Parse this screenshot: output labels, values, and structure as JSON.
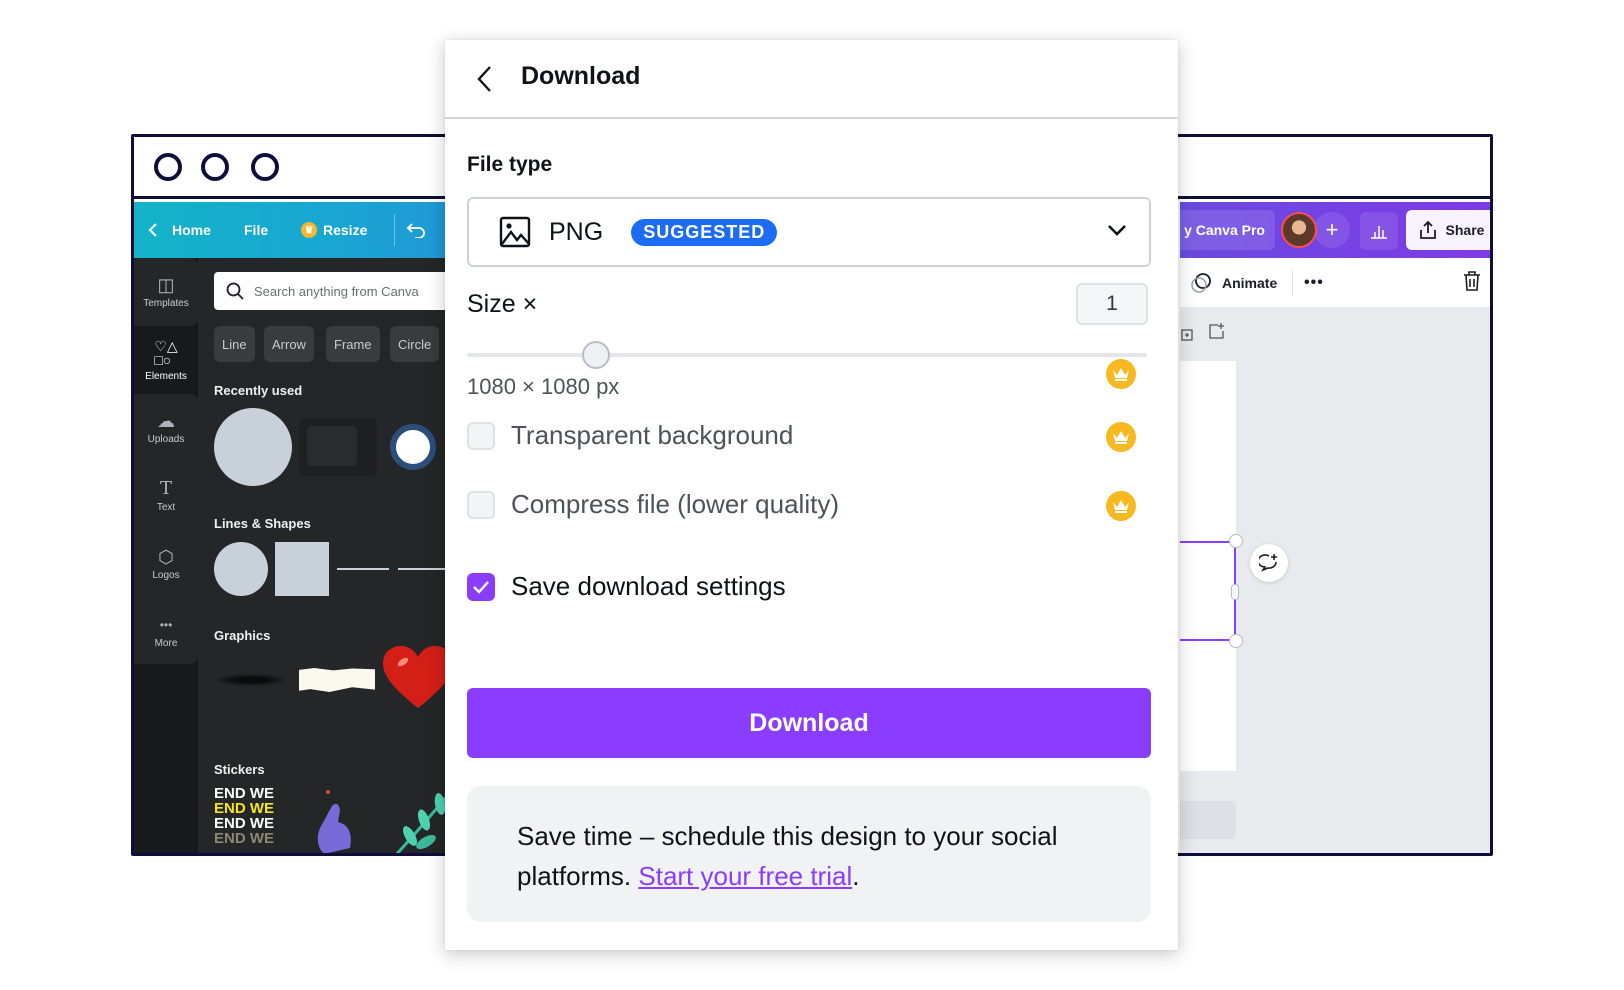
{
  "window": {
    "traffic_lights": [
      "circle",
      "circle",
      "circle"
    ]
  },
  "left_app": {
    "toolbar": {
      "back_icon": "chevron-left-icon",
      "home_label": "Home",
      "file_label": "File",
      "resize_label": "Resize",
      "resize_icon": "crown-icon",
      "undo_icon": "undo-icon"
    },
    "sidebar": {
      "items": [
        {
          "label": "Templates",
          "icon": "templates-icon",
          "glyph": "◫"
        },
        {
          "label": "Elements",
          "icon": "elements-icon",
          "glyph": "♡△"
        },
        {
          "label": "Uploads",
          "icon": "cloud-upload-icon",
          "glyph": "☁"
        },
        {
          "label": "Text",
          "icon": "text-icon",
          "glyph": "T"
        },
        {
          "label": "Logos",
          "icon": "logos-icon",
          "glyph": "⬡"
        },
        {
          "label": "More",
          "icon": "more-icon",
          "glyph": "•••"
        }
      ],
      "active": "Elements"
    },
    "panel": {
      "search_placeholder": "Search anything from Canva",
      "chips": [
        "Line",
        "Arrow",
        "Frame",
        "Circle"
      ],
      "sections": {
        "recently_used": "Recently used",
        "lines_shapes": "Lines & Shapes",
        "graphics": "Graphics",
        "stickers": "Stickers"
      },
      "sticker_text": "END WE"
    }
  },
  "right_app": {
    "toolbar": {
      "pro_label": "Try Canva Pro",
      "pro_label_visible": "y Canva Pro",
      "add_label": "+",
      "share_label": "Share"
    },
    "context_bar": {
      "animate_label": "Animate",
      "more_label": "•••"
    }
  },
  "modal": {
    "title": "Download",
    "file_type_label": "File type",
    "file_type": {
      "value": "PNG",
      "badge": "SUGGESTED",
      "icon": "image-icon"
    },
    "size": {
      "label": "Size ×",
      "value": "1",
      "slider_fraction": 0.19,
      "dimensions": "1080 × 1080 px"
    },
    "options": [
      {
        "label": "Transparent background",
        "checked": false,
        "pro": true
      },
      {
        "label": "Compress file (lower quality)",
        "checked": false,
        "pro": true
      },
      {
        "label": "Save download settings",
        "checked": true,
        "pro": false
      }
    ],
    "download_button": "Download",
    "promo": {
      "text": "Save time – schedule this design to your social platforms. ",
      "link_text": "Start your free trial",
      "suffix": "."
    }
  },
  "colors": {
    "brand_purple": "#8b3dff",
    "badge_blue": "#1d6cf6",
    "crown_gold": "#f8b81f",
    "teal_toolbar": "#14b3c7"
  }
}
